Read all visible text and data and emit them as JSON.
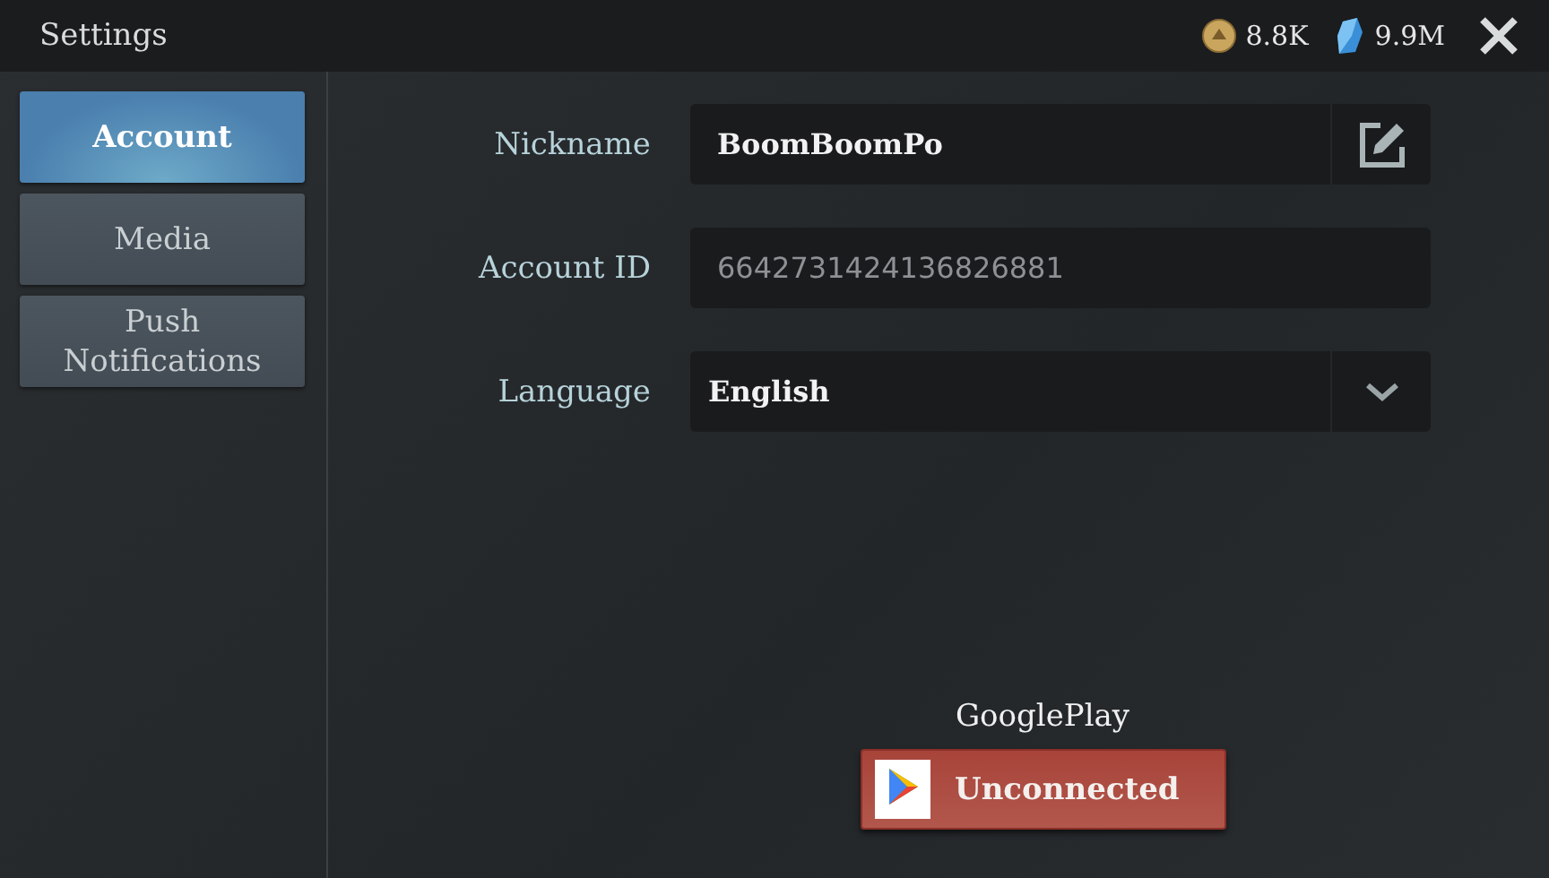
{
  "header": {
    "title": "Settings",
    "currencies": [
      {
        "kind": "coin",
        "amount": "8.8K"
      },
      {
        "kind": "gem",
        "amount": "9.9M"
      }
    ]
  },
  "tabs": [
    {
      "label": "Account",
      "selected": true
    },
    {
      "label": "Media",
      "selected": false
    },
    {
      "label": "Push Notifications",
      "selected": false
    }
  ],
  "fields": [
    {
      "label": "Nickname",
      "kind": "editable",
      "value": "BoomBoomPo"
    },
    {
      "label": "Account ID",
      "kind": "readonly",
      "value": "6642731424136826881"
    },
    {
      "label": "Language",
      "kind": "dropdown",
      "value": "English"
    }
  ],
  "google_play": {
    "title": "GooglePlay",
    "button": "Unconnected"
  }
}
